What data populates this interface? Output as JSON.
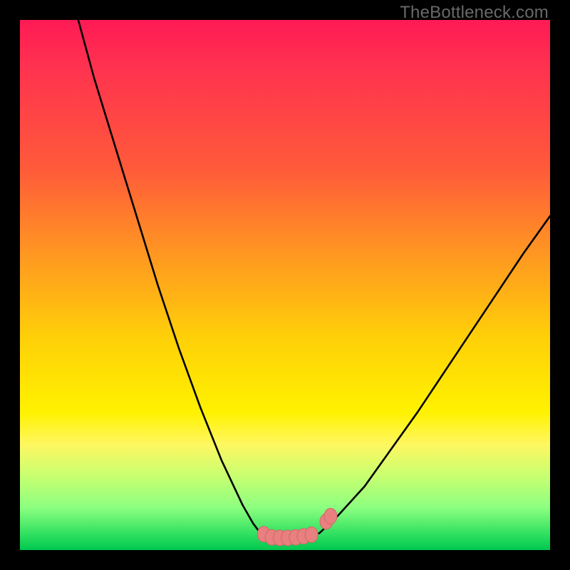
{
  "watermark": "TheBottleneck.com",
  "colors": {
    "frame": "#000000",
    "curve": "#000000",
    "marker_fill": "#e88080",
    "marker_stroke": "#d06868"
  },
  "chart_data": {
    "type": "line",
    "title": "",
    "xlabel": "",
    "ylabel": "",
    "xlim": [
      0,
      100
    ],
    "ylim": [
      0,
      100
    ],
    "grid": false,
    "legend": false,
    "series": [
      {
        "name": "left-curve",
        "x": [
          11.0,
          14.0,
          18.0,
          22.0,
          26.0,
          30.0,
          34.0,
          38.0,
          42.0,
          44.0,
          45.5
        ],
        "values": [
          100.0,
          89.0,
          76.0,
          63.0,
          50.0,
          38.0,
          27.0,
          17.0,
          8.5,
          5.0,
          3.0
        ]
      },
      {
        "name": "floor",
        "x": [
          45.5,
          48.0,
          51.0,
          54.0,
          56.5
        ],
        "values": [
          3.0,
          2.3,
          2.3,
          2.5,
          3.2
        ]
      },
      {
        "name": "right-curve",
        "x": [
          56.5,
          60.0,
          65.0,
          70.0,
          75.0,
          80.0,
          85.0,
          90.0,
          95.0,
          100.0
        ],
        "values": [
          3.2,
          6.5,
          12.0,
          19.0,
          26.0,
          33.5,
          41.0,
          48.5,
          56.0,
          63.0
        ]
      }
    ],
    "markers": [
      {
        "name": "left-marker-cluster",
        "x": 46.0,
        "y": 3.0
      },
      {
        "name": "left-marker-cluster",
        "x": 47.5,
        "y": 2.4
      },
      {
        "name": "left-marker-cluster",
        "x": 49.0,
        "y": 2.3
      },
      {
        "name": "mid-marker-cluster",
        "x": 50.5,
        "y": 2.3
      },
      {
        "name": "mid-marker-cluster",
        "x": 52.0,
        "y": 2.4
      },
      {
        "name": "mid-marker-cluster",
        "x": 53.5,
        "y": 2.6
      },
      {
        "name": "right-marker-cluster",
        "x": 55.0,
        "y": 2.9
      },
      {
        "name": "right-floating-marker",
        "x": 57.8,
        "y": 5.4
      },
      {
        "name": "right-floating-marker",
        "x": 58.6,
        "y": 6.4
      }
    ]
  }
}
